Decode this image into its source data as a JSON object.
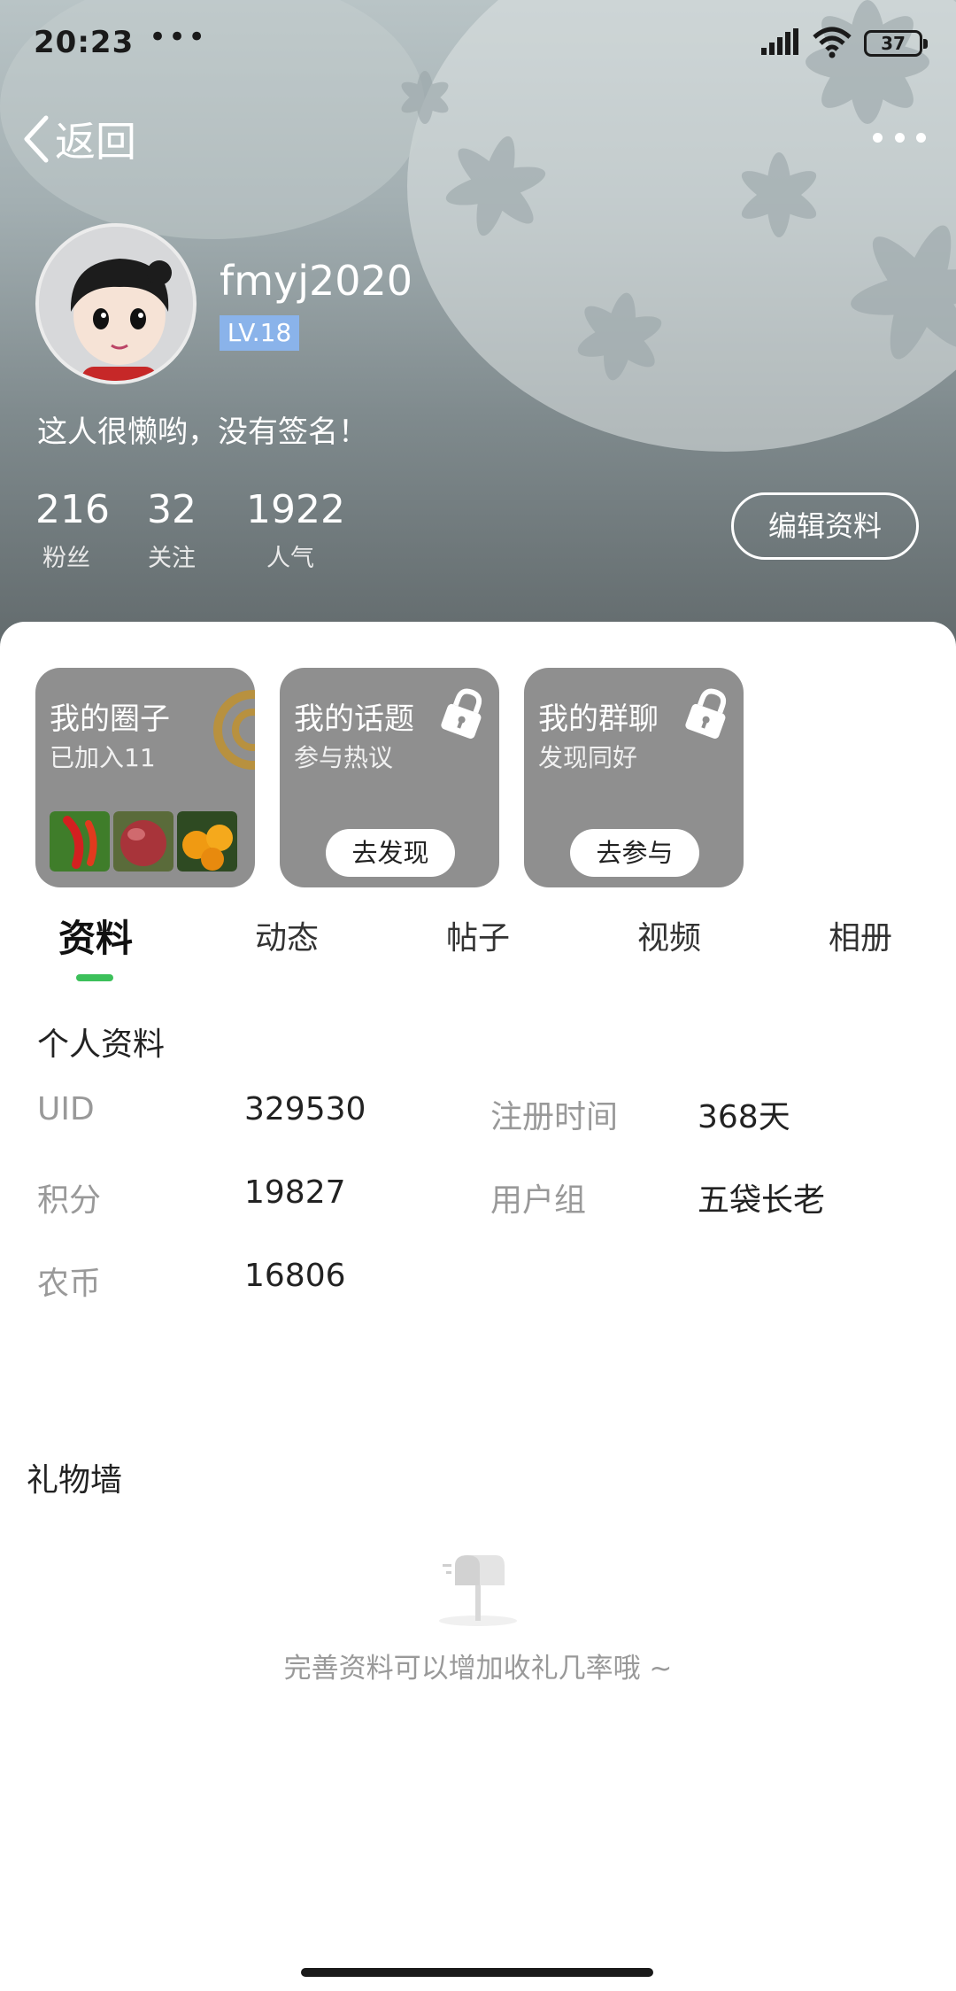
{
  "status_bar": {
    "time": "20:23",
    "dots": "•••",
    "battery_level": "37",
    "icons": [
      "signal-icon",
      "wifi-icon",
      "battery-icon"
    ]
  },
  "nav": {
    "back_label": "返回",
    "more_icon": "more-icon"
  },
  "profile": {
    "username": "fmyj2020",
    "level": "LV.18",
    "signature": "这人很懒哟，没有签名！",
    "stats": [
      {
        "value": "216",
        "label": "粉丝"
      },
      {
        "value": "32",
        "label": "关注"
      },
      {
        "value": "1922",
        "label": "人气"
      }
    ],
    "edit_label": "编辑资料"
  },
  "cards": [
    {
      "title": "我的圈子",
      "subtitle": "已加入11",
      "button": ""
    },
    {
      "title": "我的话题",
      "subtitle": "参与热议",
      "button": "去发现"
    },
    {
      "title": "我的群聊",
      "subtitle": "发现同好",
      "button": "去参与"
    }
  ],
  "tabs": [
    "资料",
    "动态",
    "帖子",
    "视频",
    "相册"
  ],
  "active_tab": "资料",
  "info": {
    "title": "个人资料",
    "fields": [
      {
        "label": "UID",
        "value": "329530"
      },
      {
        "label": "注册时间",
        "value": "368天"
      },
      {
        "label": "积分",
        "value": "19827"
      },
      {
        "label": "用户组",
        "value": "五袋长老"
      },
      {
        "label": "农币",
        "value": "16806"
      }
    ]
  },
  "gift_wall": {
    "title": "礼物墙",
    "empty_text": "完善资料可以增加收礼几率哦 ~"
  },
  "colors": {
    "accent": "#3cc05a",
    "level_badge": "#8ab3ea",
    "card_bg": "#8f8f8f"
  }
}
